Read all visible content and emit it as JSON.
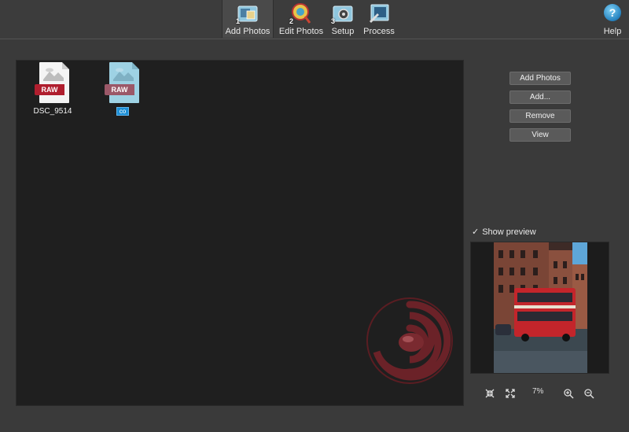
{
  "toolbar": {
    "tabs": [
      {
        "label": "Add Photos",
        "number": "1"
      },
      {
        "label": "Edit Photos",
        "number": "2"
      },
      {
        "label": "Setup",
        "number": "3"
      },
      {
        "label": "Process",
        "number": ""
      }
    ],
    "help_label": "Help",
    "help_glyph": "?"
  },
  "files": [
    {
      "name": "DSC_9514",
      "badge": "RAW"
    },
    {
      "name": "co",
      "badge": "RAW"
    }
  ],
  "buttons": {
    "add_photos": "Add Photos",
    "add": "Add...",
    "remove": "Remove",
    "view": "View"
  },
  "preview": {
    "show_label": "Show preview",
    "checked": "✓",
    "zoom": "7%"
  },
  "colors": {
    "accent": "#1d8fd6",
    "raw_badge": "#b01e2e",
    "panel": "#1f1f1f"
  }
}
